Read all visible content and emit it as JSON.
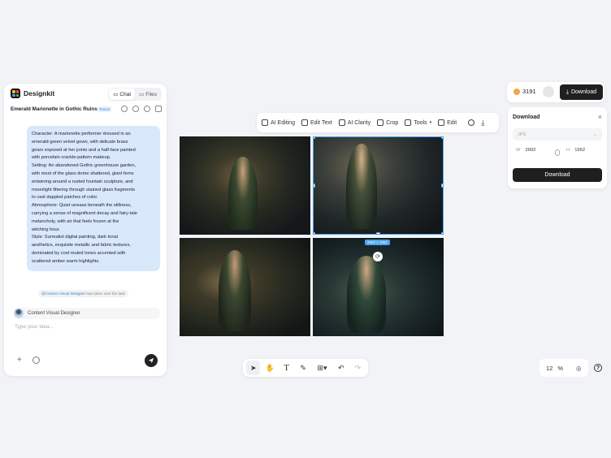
{
  "app": {
    "name": "Designkit"
  },
  "chat_panel": {
    "tabs": [
      {
        "label": "Chat"
      },
      {
        "label": "Files"
      }
    ],
    "project_title": "Emerald Marionette in Gothic Ruins",
    "team_badge": "Teams",
    "message_lines": [
      "Character: A marionette performer dressed in an",
      "emerald-green velvet gown, with delicate brass",
      "gears exposed at her joints and a half-face painted",
      "with porcelain crackle-pattern makeup.",
      "Setting: An abandoned Gothic greenhouse garden,",
      "with most of the glass dome shattered, giant ferns",
      "entwining around a rusted fountain sculpture, and",
      "moonlight filtering through stained glass fragments",
      "to cast dappled patches of color.",
      "Atmosphere: Quiet unease beneath the stillness,",
      "carrying a sense of magnificent decay and fairy-tale",
      "melancholy, with air that feels frozen at the",
      "witching hour.",
      "Style: Surrealist digital painting, dark tonal",
      "aesthetics, exquisite metallic and fabric textures,",
      "dominated by cool muted tones accented with",
      "scattered amber warm highlights."
    ],
    "handover_agent": "@Content Visual Designer",
    "handover_text": "has taken over the task",
    "agent_name": "Content Visual Designer",
    "input_placeholder": "Type your idea..."
  },
  "toolbar": {
    "items": [
      {
        "label": "AI Editing",
        "icon": "ai-editing-icon"
      },
      {
        "label": "Edit Text",
        "icon": "edit-text-icon"
      },
      {
        "label": "AI Clarity",
        "icon": "ai-clarity-icon"
      },
      {
        "label": "Crop",
        "icon": "crop-icon"
      },
      {
        "label": "Tools",
        "icon": "tools-icon"
      },
      {
        "label": "Edit",
        "icon": "sliders-icon"
      }
    ]
  },
  "canvas": {
    "selected_size": "2602 x 1952"
  },
  "header": {
    "credits": "3191",
    "download_label": "Download"
  },
  "download_panel": {
    "title": "Download",
    "format": "JPG",
    "width_label": "W",
    "width_value": "2602",
    "height_label": "H",
    "height_value": "1952",
    "action_label": "Download"
  },
  "zoom": {
    "value": "12",
    "unit": "%"
  }
}
